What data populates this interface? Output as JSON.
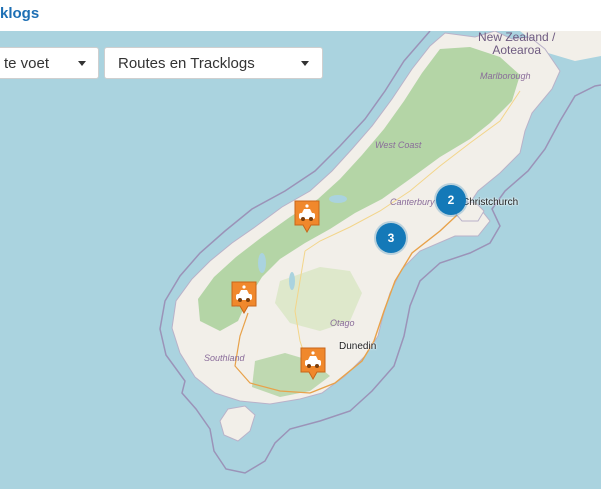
{
  "header": {
    "title": "klogs"
  },
  "filters": {
    "mode": {
      "selected": "te voet"
    },
    "type": {
      "selected": "Routes en Tracklogs"
    }
  },
  "map": {
    "country_label_line1": "New Zealand /",
    "country_label_line2": "Aotearoa",
    "regions": {
      "marlborough": "Marlborough",
      "west_coast": "West Coast",
      "canterbury": "Canterbury",
      "otago": "Otago",
      "southland": "Southland"
    },
    "cities": {
      "christchurch": "Christchurch",
      "dunedin": "Dunedin"
    },
    "clusters": [
      {
        "count": "2"
      },
      {
        "count": "3"
      }
    ],
    "colors": {
      "water": "#aad3df",
      "land": "#f2efe9",
      "forest": "#add19e",
      "cluster": "#1479b8",
      "marker": "#f0882c"
    },
    "markers": [
      {
        "icon": "car-route-icon"
      },
      {
        "icon": "car-route-icon"
      },
      {
        "icon": "car-route-icon"
      }
    ]
  }
}
